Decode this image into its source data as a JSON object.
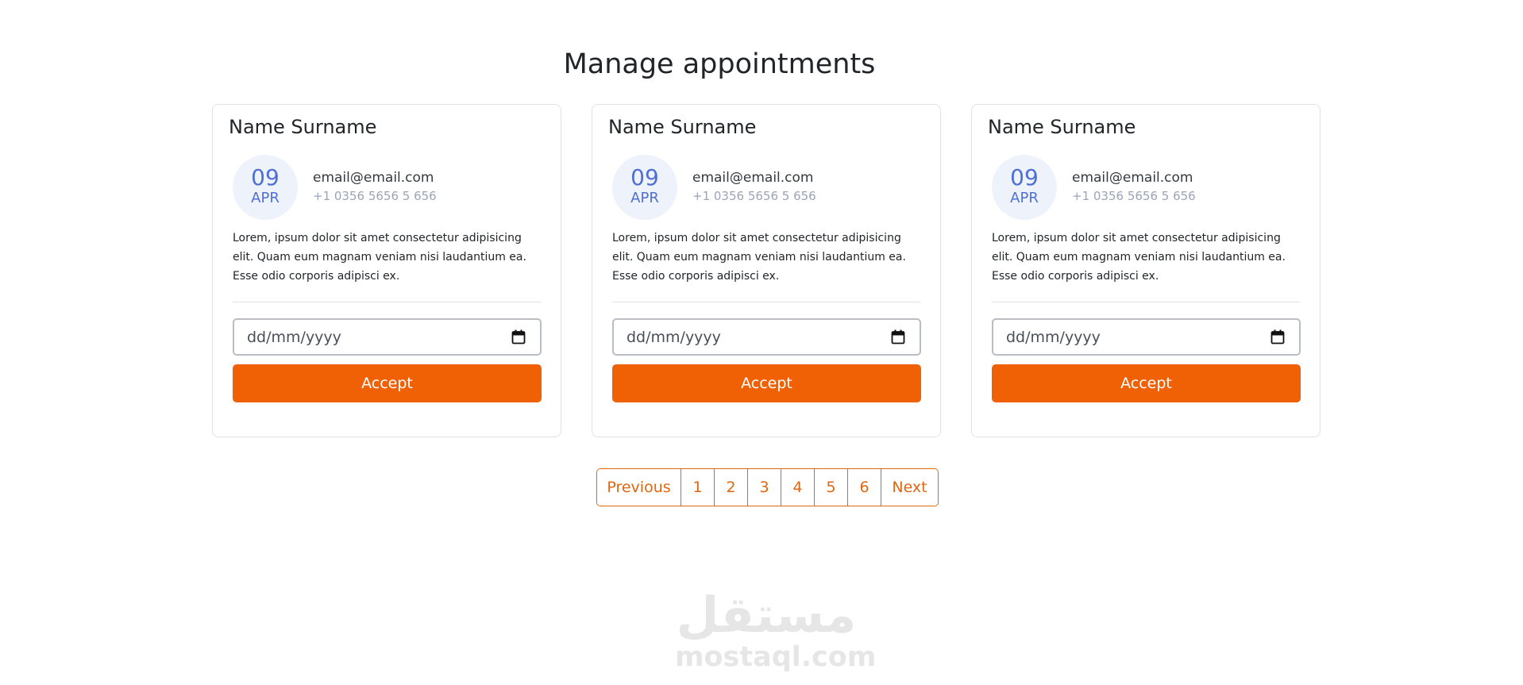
{
  "page": {
    "title": "Manage appointments"
  },
  "cards": [
    {
      "name": "Name Surname",
      "day": "09",
      "month": "APR",
      "email": "email@email.com",
      "phone": "+1 0356 5656 5 656",
      "description": "Lorem, ipsum dolor sit amet consectetur adipisicing elit. Quam eum magnam veniam nisi laudantium ea. Esse odio corporis adipisci ex.",
      "date_placeholder": "dd/mm/yyyy",
      "accept_label": "Accept"
    },
    {
      "name": "Name Surname",
      "day": "09",
      "month": "APR",
      "email": "email@email.com",
      "phone": "+1 0356 5656 5 656",
      "description": "Lorem, ipsum dolor sit amet consectetur adipisicing elit. Quam eum magnam veniam nisi laudantium ea. Esse odio corporis adipisci ex.",
      "date_placeholder": "dd/mm/yyyy",
      "accept_label": "Accept"
    },
    {
      "name": "Name Surname",
      "day": "09",
      "month": "APR",
      "email": "email@email.com",
      "phone": "+1 0356 5656 5 656",
      "description": "Lorem, ipsum dolor sit amet consectetur adipisicing elit. Quam eum magnam veniam nisi laudantium ea. Esse odio corporis adipisci ex.",
      "date_placeholder": "dd/mm/yyyy",
      "accept_label": "Accept"
    }
  ],
  "pagination": {
    "previous": "Previous",
    "pages": [
      "1",
      "2",
      "3",
      "4",
      "5",
      "6"
    ],
    "next": "Next"
  },
  "watermark": {
    "arabic": "مستقل",
    "latin": "mostaql.com"
  },
  "colors": {
    "accent": "#f06105",
    "date_circle_bg": "#eef2fb",
    "date_text": "#4f6fd4",
    "phone_text": "#9aa5b8",
    "card_border": "#dfe2e6"
  },
  "icons": {
    "date_input": "calendar-icon"
  }
}
